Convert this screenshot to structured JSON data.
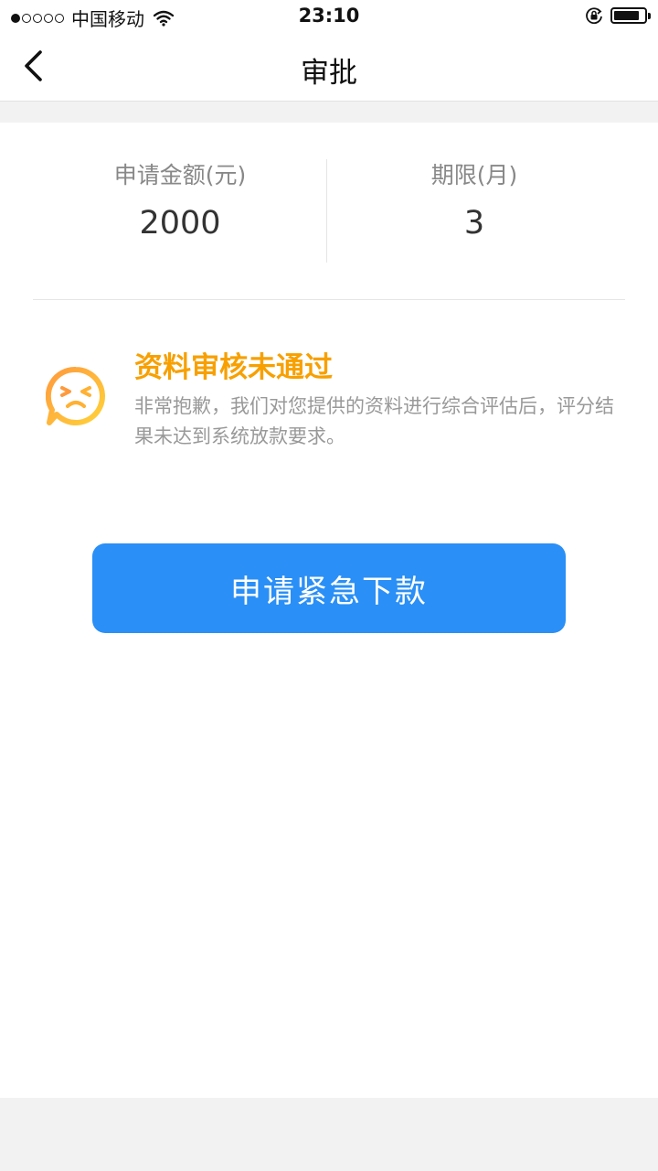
{
  "status_bar": {
    "signal_filled": 1,
    "signal_total": 5,
    "carrier": "中国移动",
    "time": "23:10",
    "battery_level": 0.85,
    "icons": [
      "wifi-icon",
      "orientation-lock-icon",
      "battery-icon"
    ]
  },
  "nav": {
    "title": "审批",
    "back_icon": "chevron-left-icon"
  },
  "summary": {
    "amount_label": "申请金额(元)",
    "amount_value": "2000",
    "term_label": "期限(月)",
    "term_value": "3"
  },
  "result": {
    "icon": "sad-face-chat-icon",
    "title": "资料审核未通过",
    "description": "非常抱歉，我们对您提供的资料进行综合评估后，评分结果未达到系统放款要求。",
    "title_color": "#f7a000"
  },
  "action": {
    "button_label": "申请紧急下款",
    "button_color": "#2a8ff6"
  }
}
